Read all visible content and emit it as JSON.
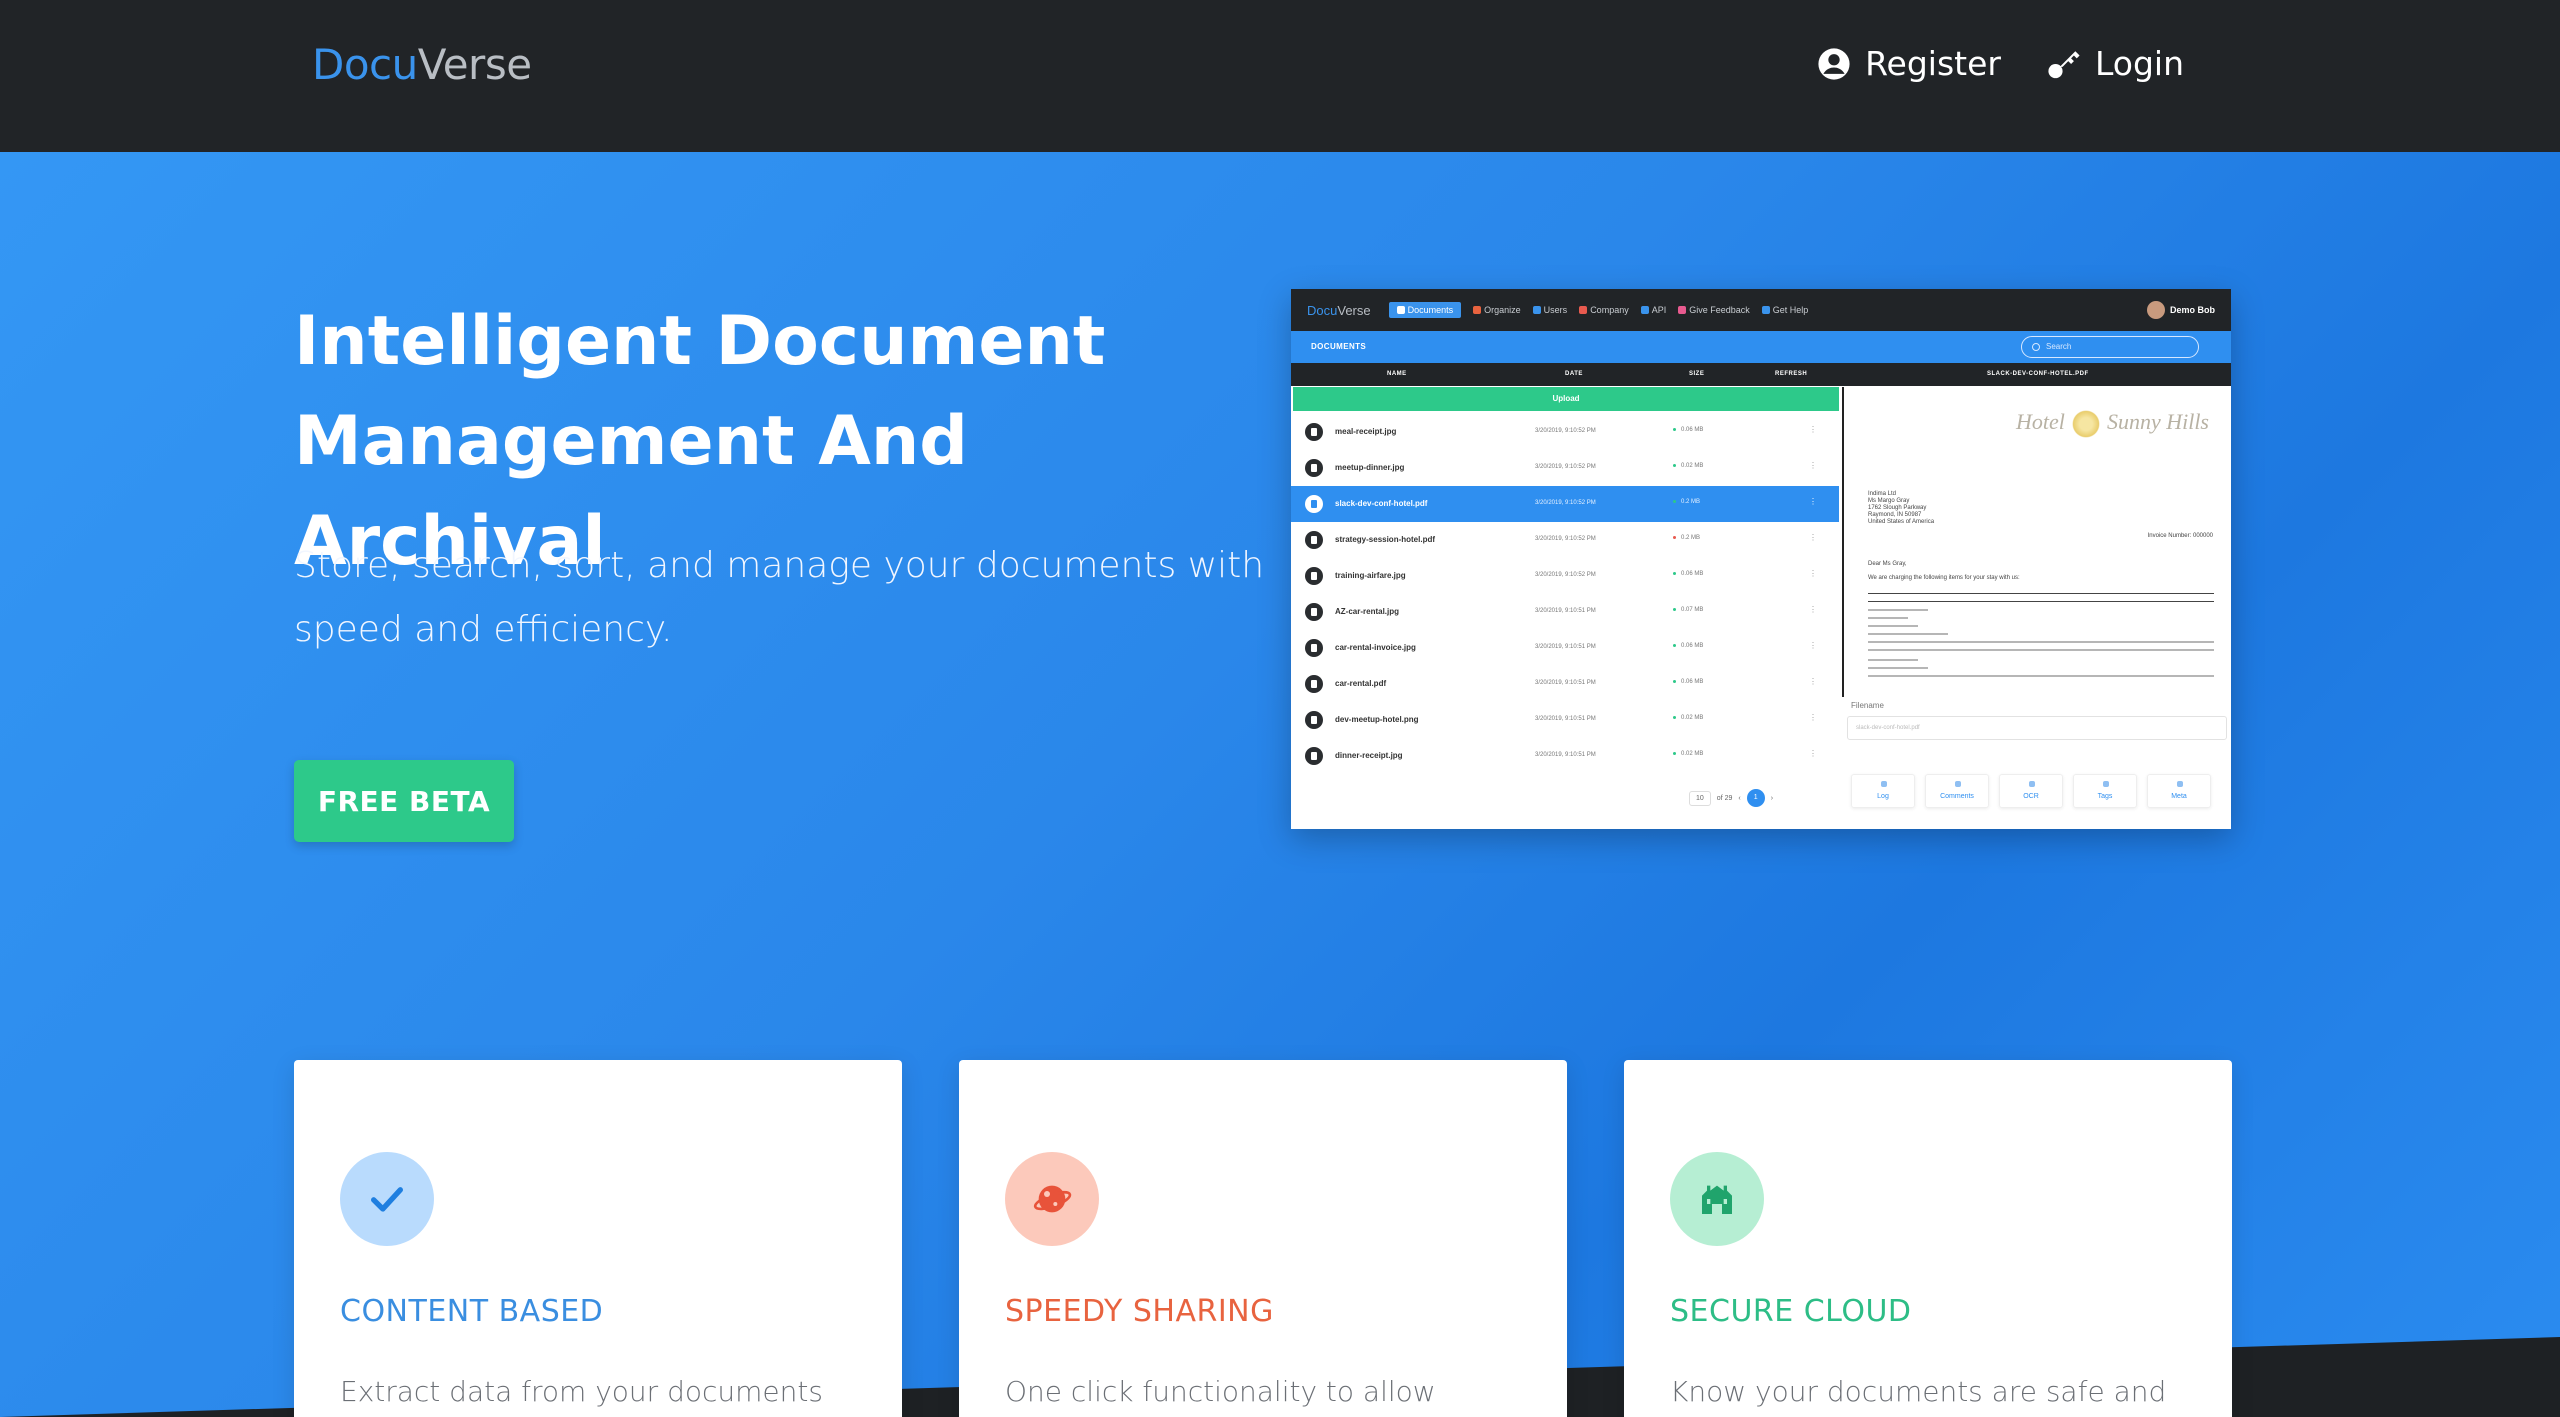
{
  "brand": {
    "part1": "Docu",
    "part2": "Verse"
  },
  "nav": {
    "register": "Register",
    "login": "Login"
  },
  "hero": {
    "title": "Intelligent Document Management And Archival",
    "subtitle": "Store, search, sort, and manage your documents with speed and efficiency.",
    "cta": "FREE BETA"
  },
  "mock": {
    "brand1": "Docu",
    "brand2": "Verse",
    "menu": [
      "Documents",
      "Organize",
      "Users",
      "Company",
      "API",
      "Give Feedback",
      "Get Help"
    ],
    "user": "Demo Bob",
    "bar_title": "DOCUMENTS",
    "search_placeholder": "Search",
    "columns": [
      "NAME",
      "DATE",
      "SIZE",
      "REFRESH",
      "SLACK-DEV-CONF-HOTEL.PDF"
    ],
    "upload": "Upload",
    "rows": [
      {
        "name": "meal-receipt.jpg",
        "date": "3/20/2019, 9:10:52 PM",
        "size": "0.06 MB"
      },
      {
        "name": "meetup-dinner.jpg",
        "date": "3/20/2019, 9:10:52 PM",
        "size": "0.02 MB"
      },
      {
        "name": "slack-dev-conf-hotel.pdf",
        "date": "3/20/2019, 9:10:52 PM",
        "size": "0.2 MB"
      },
      {
        "name": "strategy-session-hotel.pdf",
        "date": "3/20/2019, 9:10:52 PM",
        "size": "0.2 MB"
      },
      {
        "name": "training-airfare.jpg",
        "date": "3/20/2019, 9:10:52 PM",
        "size": "0.06 MB"
      },
      {
        "name": "AZ-car-rental.jpg",
        "date": "3/20/2019, 9:10:51 PM",
        "size": "0.07 MB"
      },
      {
        "name": "car-rental-invoice.jpg",
        "date": "3/20/2019, 9:10:51 PM",
        "size": "0.06 MB"
      },
      {
        "name": "car-rental.pdf",
        "date": "3/20/2019, 9:10:51 PM",
        "size": "0.06 MB"
      },
      {
        "name": "dev-meetup-hotel.png",
        "date": "3/20/2019, 9:10:51 PM",
        "size": "0.02 MB"
      },
      {
        "name": "dinner-receipt.jpg",
        "date": "3/20/2019, 9:10:51 PM",
        "size": "0.02 MB"
      }
    ],
    "pager": {
      "size": "10",
      "of": "of 29",
      "current": "1"
    },
    "preview": {
      "hotel": "Hotel",
      "hotel2": "Sunny Hills",
      "greeting": "Dear Ms Gray,",
      "charging": "We are charging the following items for your stay with us:",
      "invoice_no": "Invoice Number: 000000",
      "address": "Indima Ltd\nMs Margo Gray\n1762 Slough Parkway\nRaymond, IN 50987\nUnited States of America"
    },
    "filename_label": "Filename",
    "filename_value": "slack-dev-conf-hotel.pdf",
    "tabs": [
      "Log",
      "Comments",
      "OCR",
      "Tags",
      "Meta"
    ]
  },
  "features": [
    {
      "title": "CONTENT BASED",
      "text": "Extract data from your documents using",
      "color": "#3a8ee0",
      "icon": "check-icon",
      "bg": "#b9dbfd"
    },
    {
      "title": "SPEEDY SHARING",
      "text": "One click functionality to allow others to",
      "color": "#e8633f",
      "icon": "planet-icon",
      "bg": "#fcc9bb"
    },
    {
      "title": "SECURE CLOUD",
      "text": "Know your documents are safe and",
      "color": "#2dbd86",
      "icon": "building-icon",
      "bg": "#b6eed3"
    }
  ]
}
